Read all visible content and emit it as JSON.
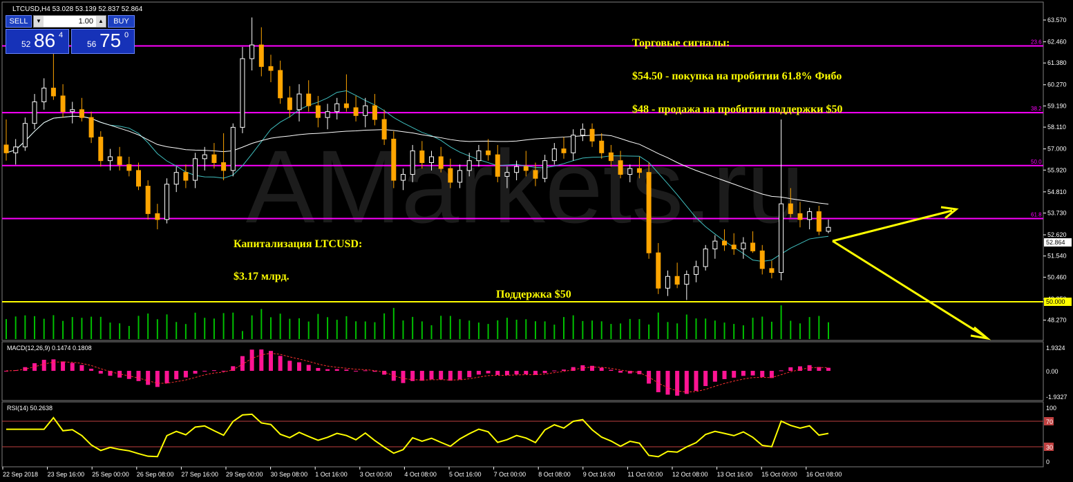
{
  "header": {
    "symbol_info": "LTCUSD,H4  53.028 53.139 52.837 52.864"
  },
  "trade_widget": {
    "sell_label": "SELL",
    "buy_label": "BUY",
    "lot": "1.00",
    "bid_small": "52",
    "bid_big": "86",
    "bid_sup": "4",
    "ask_small": "56",
    "ask_big": "75",
    "ask_sup": "0"
  },
  "watermark": "AMarkets.ru",
  "annotations": {
    "signals_title": "Торговые сигналы:",
    "signal_buy": "$54.50 - покупка на пробитии 61.8% Фибо",
    "signal_sell": "$48 - продажа на пробитии поддержки $50",
    "cap_title": "Капитализация LTCUSD:",
    "cap_value": "$3.17 млрд.",
    "support_label": "Поддержка $50"
  },
  "price_axis": [
    "63.570",
    "62.460",
    "61.380",
    "60.270",
    "59.190",
    "58.110",
    "57.000",
    "55.920",
    "54.810",
    "53.730",
    "52.620",
    "51.540",
    "50.460",
    "49.350",
    "48.270"
  ],
  "current_price_tag": "52.864",
  "support_tag": "50.000",
  "fib_levels": [
    {
      "label": "23.6",
      "price": 62.25
    },
    {
      "label": "38.2",
      "price": 58.85
    },
    {
      "label": "50.0",
      "price": 56.15
    },
    {
      "label": "61.8",
      "price": 53.45
    }
  ],
  "support_level": 50.0,
  "macd": {
    "label": "MACD(12,26,9) 0.1474 0.1808",
    "axis": [
      "1.9324",
      "0.00",
      "-1.9327"
    ]
  },
  "rsi": {
    "label": "RSI(14) 50.2638",
    "axis": [
      "100",
      "70",
      "30",
      "0"
    ],
    "levels": [
      "70",
      "30"
    ]
  },
  "time_axis": [
    "22 Sep 2018",
    "23 Sep 16:00",
    "25 Sep 00:00",
    "26 Sep 08:00",
    "27 Sep 16:00",
    "29 Sep 00:00",
    "30 Sep 08:00",
    "1 Oct 16:00",
    "3 Oct 00:00",
    "4 Oct 08:00",
    "5 Oct 16:00",
    "7 Oct 00:00",
    "8 Oct 08:00",
    "9 Oct 16:00",
    "11 Oct 00:00",
    "12 Oct 08:00",
    "13 Oct 16:00",
    "15 Oct 00:00",
    "16 Oct 08:00"
  ],
  "colors": {
    "background": "#000000",
    "bull_candle": "#ffffff",
    "bear_candle": "#ffa500",
    "fib_line": "#ff00ff",
    "support_line": "#ffff00",
    "ma_fast": "#40c0c0",
    "ma_slow": "#ffffff",
    "volume": "#00c000",
    "macd_hist": "#ff1493",
    "rsi_line": "#ffff00",
    "annotation_text": "#ffff00",
    "arrow": "#ffff00",
    "grid_frame": "#808080"
  },
  "chart_data": {
    "type": "candlestick",
    "symbol": "LTCUSD",
    "timeframe": "H4",
    "ylim": [
      48.2,
      64.0
    ],
    "ohlc": [
      [
        57.2,
        58.5,
        56.4,
        56.8
      ],
      [
        56.8,
        57.5,
        56.2,
        57.1
      ],
      [
        57.1,
        58.6,
        56.9,
        58.3
      ],
      [
        58.3,
        59.8,
        58.0,
        59.4
      ],
      [
        59.4,
        60.6,
        59.0,
        60.1
      ],
      [
        60.1,
        61.9,
        59.5,
        59.7
      ],
      [
        59.7,
        60.3,
        58.6,
        58.9
      ],
      [
        58.9,
        59.4,
        58.3,
        59.0
      ],
      [
        59.0,
        59.6,
        58.4,
        58.6
      ],
      [
        58.6,
        58.9,
        57.3,
        57.6
      ],
      [
        57.6,
        57.9,
        56.1,
        56.4
      ],
      [
        56.4,
        57.0,
        55.9,
        56.6
      ],
      [
        56.6,
        57.1,
        55.9,
        56.2
      ],
      [
        56.2,
        56.6,
        55.6,
        55.9
      ],
      [
        55.9,
        56.3,
        54.9,
        55.1
      ],
      [
        55.1,
        55.4,
        53.4,
        53.7
      ],
      [
        53.7,
        54.2,
        52.9,
        53.4
      ],
      [
        53.4,
        55.5,
        53.2,
        55.2
      ],
      [
        55.2,
        56.1,
        54.8,
        55.8
      ],
      [
        55.8,
        56.2,
        55.0,
        55.4
      ],
      [
        55.4,
        56.8,
        55.0,
        56.5
      ],
      [
        56.5,
        57.1,
        55.9,
        56.7
      ],
      [
        56.7,
        57.3,
        56.0,
        56.3
      ],
      [
        56.3,
        57.8,
        55.4,
        55.9
      ],
      [
        55.9,
        58.3,
        55.6,
        58.1
      ],
      [
        58.1,
        62.2,
        57.8,
        61.6
      ],
      [
        61.6,
        63.7,
        61.0,
        62.3
      ],
      [
        62.3,
        63.2,
        60.7,
        61.2
      ],
      [
        61.2,
        61.8,
        60.4,
        61.0
      ],
      [
        61.0,
        61.5,
        59.3,
        59.6
      ],
      [
        59.6,
        60.2,
        58.6,
        59.0
      ],
      [
        59.0,
        60.3,
        58.4,
        59.8
      ],
      [
        59.8,
        60.5,
        58.9,
        59.2
      ],
      [
        59.2,
        59.7,
        58.1,
        58.6
      ],
      [
        58.6,
        59.3,
        58.0,
        58.9
      ],
      [
        58.9,
        59.6,
        58.5,
        59.3
      ],
      [
        59.3,
        60.8,
        58.9,
        59.1
      ],
      [
        59.1,
        59.7,
        58.4,
        58.7
      ],
      [
        58.7,
        59.6,
        58.1,
        59.2
      ],
      [
        59.2,
        59.8,
        58.2,
        58.5
      ],
      [
        58.5,
        59.0,
        57.2,
        57.5
      ],
      [
        57.5,
        57.9,
        55.0,
        55.4
      ],
      [
        55.4,
        56.0,
        54.9,
        55.7
      ],
      [
        55.7,
        57.2,
        55.3,
        56.9
      ],
      [
        56.9,
        57.4,
        56.0,
        56.3
      ],
      [
        56.3,
        56.9,
        55.9,
        56.6
      ],
      [
        56.6,
        57.1,
        55.8,
        56.0
      ],
      [
        56.0,
        56.5,
        55.0,
        55.3
      ],
      [
        55.3,
        56.2,
        55.0,
        55.9
      ],
      [
        55.9,
        56.8,
        55.6,
        56.4
      ],
      [
        56.4,
        57.2,
        56.1,
        56.9
      ],
      [
        56.9,
        57.5,
        56.4,
        56.7
      ],
      [
        56.7,
        57.2,
        55.3,
        55.6
      ],
      [
        55.6,
        56.1,
        55.0,
        55.8
      ],
      [
        55.8,
        56.4,
        55.4,
        56.1
      ],
      [
        56.1,
        56.9,
        55.6,
        55.9
      ],
      [
        55.9,
        56.3,
        55.1,
        55.5
      ],
      [
        55.5,
        56.7,
        55.3,
        56.4
      ],
      [
        56.4,
        57.3,
        56.2,
        57.0
      ],
      [
        57.0,
        57.6,
        56.5,
        56.8
      ],
      [
        56.8,
        58.0,
        56.4,
        57.7
      ],
      [
        57.7,
        58.3,
        57.4,
        58.0
      ],
      [
        58.0,
        58.3,
        57.1,
        57.4
      ],
      [
        57.4,
        57.8,
        56.5,
        56.8
      ],
      [
        56.8,
        57.2,
        56.1,
        56.4
      ],
      [
        56.4,
        56.9,
        55.5,
        55.7
      ],
      [
        55.7,
        56.2,
        55.3,
        56.0
      ],
      [
        56.0,
        56.6,
        55.5,
        55.8
      ],
      [
        55.8,
        56.3,
        51.4,
        51.7
      ],
      [
        51.7,
        52.2,
        49.6,
        49.9
      ],
      [
        49.9,
        50.8,
        49.5,
        50.5
      ],
      [
        50.5,
        51.2,
        49.9,
        50.1
      ],
      [
        50.1,
        50.8,
        49.3,
        50.6
      ],
      [
        50.6,
        51.3,
        50.2,
        51.0
      ],
      [
        51.0,
        52.1,
        50.8,
        51.9
      ],
      [
        51.9,
        52.6,
        51.4,
        52.3
      ],
      [
        52.3,
        52.9,
        51.8,
        52.1
      ],
      [
        52.1,
        52.7,
        51.6,
        51.9
      ],
      [
        51.9,
        52.5,
        51.4,
        52.2
      ],
      [
        52.2,
        52.8,
        51.7,
        51.8
      ],
      [
        51.8,
        52.1,
        50.6,
        50.9
      ],
      [
        50.9,
        51.3,
        50.4,
        50.7
      ],
      [
        50.7,
        58.5,
        50.3,
        54.2
      ],
      [
        54.2,
        55.0,
        53.5,
        53.7
      ],
      [
        53.7,
        54.3,
        53.0,
        53.4
      ],
      [
        53.4,
        54.0,
        52.9,
        53.8
      ],
      [
        53.8,
        54.1,
        52.6,
        52.8
      ],
      [
        52.8,
        53.4,
        52.7,
        53.0
      ]
    ],
    "annotations": [
      "Торговые сигналы:",
      "$54.50 - покупка на пробитии 61.8% Фибо",
      "$48 - продажа на пробитии поддержки $50",
      "Капитализация LTCUSD:",
      "$3.17 млрд.",
      "Поддержка $50"
    ]
  }
}
